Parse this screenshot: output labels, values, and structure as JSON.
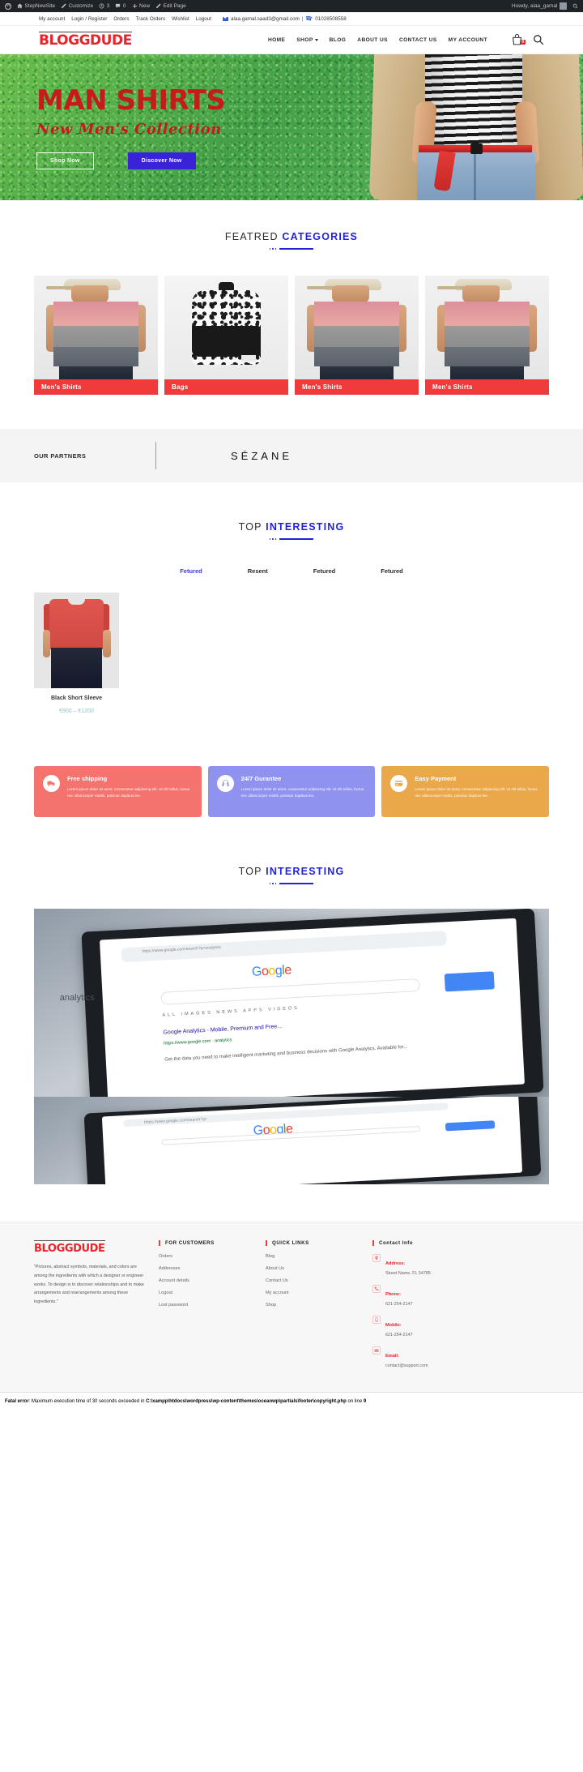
{
  "adminbar": {
    "items": [
      {
        "icon": "wordpress-logo-icon",
        "label": ""
      },
      {
        "icon": "home-icon",
        "label": "StepNewSite"
      },
      {
        "icon": "pencil-icon",
        "label": "Customize"
      },
      {
        "icon": "updates-icon",
        "label": "3"
      },
      {
        "icon": "comment-icon",
        "label": "0"
      },
      {
        "icon": "plus-icon",
        "label": "New"
      },
      {
        "icon": "edit-icon",
        "label": "Edit Page"
      }
    ],
    "howdy": "Howdy, alaa_gamal",
    "search_icon": "search-icon"
  },
  "topbar": {
    "links": [
      "My account",
      "Login / Register",
      "Orders",
      "Track Orders",
      "Wishlist",
      "Logout"
    ],
    "email": "alaa.gamal.saad3@gmail.com",
    "separator": "|",
    "phone": "01028508558"
  },
  "header": {
    "logo": "BLOGGDUDE",
    "nav": [
      {
        "label": "HOME",
        "has_dropdown": false
      },
      {
        "label": "SHOP",
        "has_dropdown": true
      },
      {
        "label": "BLOG",
        "has_dropdown": false
      },
      {
        "label": "ABOUT US",
        "has_dropdown": false
      },
      {
        "label": "CONTACT US",
        "has_dropdown": false
      },
      {
        "label": "MY ACCOUNT",
        "has_dropdown": false
      }
    ],
    "cart_count": "0",
    "cart_icon": "shopping-bag-icon",
    "search_icon": "search-icon"
  },
  "hero": {
    "title": "MAN SHIRTS",
    "subtitle": "New Men's Collection",
    "btn_outline": "Shop Now",
    "btn_solid": "Discover Now",
    "title_color": "#c41b1b",
    "solid_btn_color": "#3a22d8"
  },
  "categories": {
    "heading_light": "FEATRED",
    "heading_bold": "CATEGORIES",
    "accent": "#2222dd",
    "items": [
      {
        "label": "Men's Shirts",
        "image": "model-shirt-photo"
      },
      {
        "label": "Bags",
        "image": "backpack-photo"
      },
      {
        "label": "Men's Shirts",
        "image": "model-shirt-photo"
      },
      {
        "label": "Men's Shirts",
        "image": "model-shirt-photo"
      }
    ],
    "label_color": "#ef3b3b"
  },
  "partners": {
    "label": "OUR PARTNERS",
    "logo": "SÉZANE"
  },
  "interesting": {
    "heading_light": "TOP",
    "heading_bold": "INTERESTING",
    "tabs": [
      {
        "label": "Fetured",
        "active": true
      },
      {
        "label": "Resent",
        "active": false
      },
      {
        "label": "Fetured",
        "active": false
      },
      {
        "label": "Fetured",
        "active": false
      }
    ],
    "products": [
      {
        "name": "Black Short Sleeve",
        "price": "€900 – €1200",
        "image": "red-tshirt-photo"
      }
    ]
  },
  "features": [
    {
      "icon": "truck-icon",
      "title": "Free shipping",
      "text": "Lorem ipsum dolor sit amet, consectetur adipiscing elit. Ut elit tellus, luctus nec ullamcorper mattis, pulvinar dapibus leo.",
      "color": "#f4736f"
    },
    {
      "icon": "headset-icon",
      "title": "24/7 Gurantee",
      "text": "Lorem ipsum dolor sit amet, consectetur adipiscing elit. Ut elit tellus, luctus nec ullamcorper mattis, pulvinar dapibus leo.",
      "color": "#8f93ef"
    },
    {
      "icon": "card-icon",
      "title": "Easy Payment",
      "text": "Lorem ipsum dolor sit amet, consectetur adipiscing elit. Ut elit tellus, luctus nec ullamcorper mattis, pulvinar dapibus leo.",
      "color": "#eaa84b"
    }
  ],
  "blog": {
    "heading_light": "TOP",
    "heading_bold": "INTERESTING",
    "images": [
      {
        "name": "google-analytics-tablet-photo",
        "url_text": "https://www.google.com/search?q=analytics",
        "logo": "Google",
        "tabs": "ALL   IMAGES   NEWS   APPS   VIDEOS",
        "result_title": "Google Analytics - Mobile, Premium and Free...",
        "result_url": "https://www.google.com - analytics",
        "result_desc": "Get the data you need to make intelligent marketing and business decisions with Google Analytics. Available for...",
        "overlay_word": "analytics"
      },
      {
        "name": "google-analytics-tablet-photo-2",
        "url_text": "https://www.google.com/search?q=",
        "logo": "Google"
      }
    ]
  },
  "footer": {
    "logo": "BLOGGDUDE",
    "description": "\"Pictures, abstract symbols, materials, and colors are among the ingredients with which a designer or engineer works. To design is to discover relationships and to make arrangements and rearrangements among these ingredients.\"",
    "columns": [
      {
        "heading": "FOR CUSTOMERS",
        "links": [
          "Orders",
          "Addresses",
          "Account details",
          "Logout",
          "Lost password"
        ]
      },
      {
        "heading": "QUICK LINKS",
        "links": [
          "Blog",
          "About Us",
          "Contact Us",
          "My account",
          "Shop"
        ]
      }
    ],
    "contact": {
      "heading": "Contact Info",
      "rows": [
        {
          "icon": "location-icon",
          "label": "Address:",
          "value": "Street Name, FL 54785"
        },
        {
          "icon": "phone-icon",
          "label": "Phone:",
          "value": "621-254-2147"
        },
        {
          "icon": "mobile-icon",
          "label": "Mobile:",
          "value": "621-254-2147"
        },
        {
          "icon": "envelope-icon",
          "label": "Email:",
          "value": "contact@support.com"
        }
      ]
    }
  },
  "fatal_error": {
    "prefix": "Fatal error",
    "message": ": Maximum execution time of 30 seconds exceeded in ",
    "path": "C:\\xampp\\htdocs\\wordpress\\wp-content\\themes\\oceanwp\\partials\\footer\\copyright.php",
    "suffix": " on line ",
    "line": "9"
  }
}
